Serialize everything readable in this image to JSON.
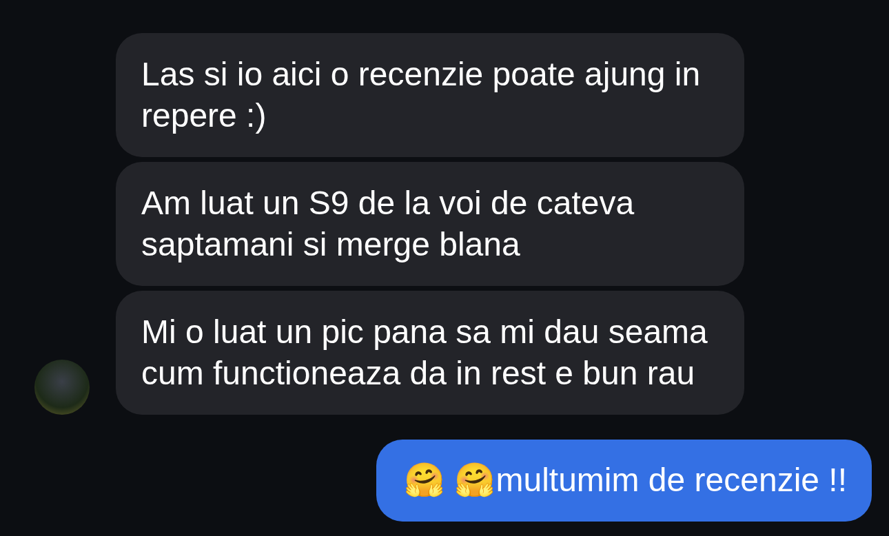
{
  "messages": [
    {
      "kind": "incoming",
      "text": "Las si io aici o recenzie poate ajung in repere :)",
      "avatar": false
    },
    {
      "kind": "incoming",
      "text": "Am luat un S9 de la voi de cateva saptamani si merge blana",
      "avatar": false
    },
    {
      "kind": "incoming",
      "text": "Mi o luat un pic pana sa mi dau seama cum functioneaza da in rest e bun rau",
      "avatar": true
    },
    {
      "kind": "outgoing",
      "text": "🤗 🤗multumim de recenzie !!"
    }
  ]
}
